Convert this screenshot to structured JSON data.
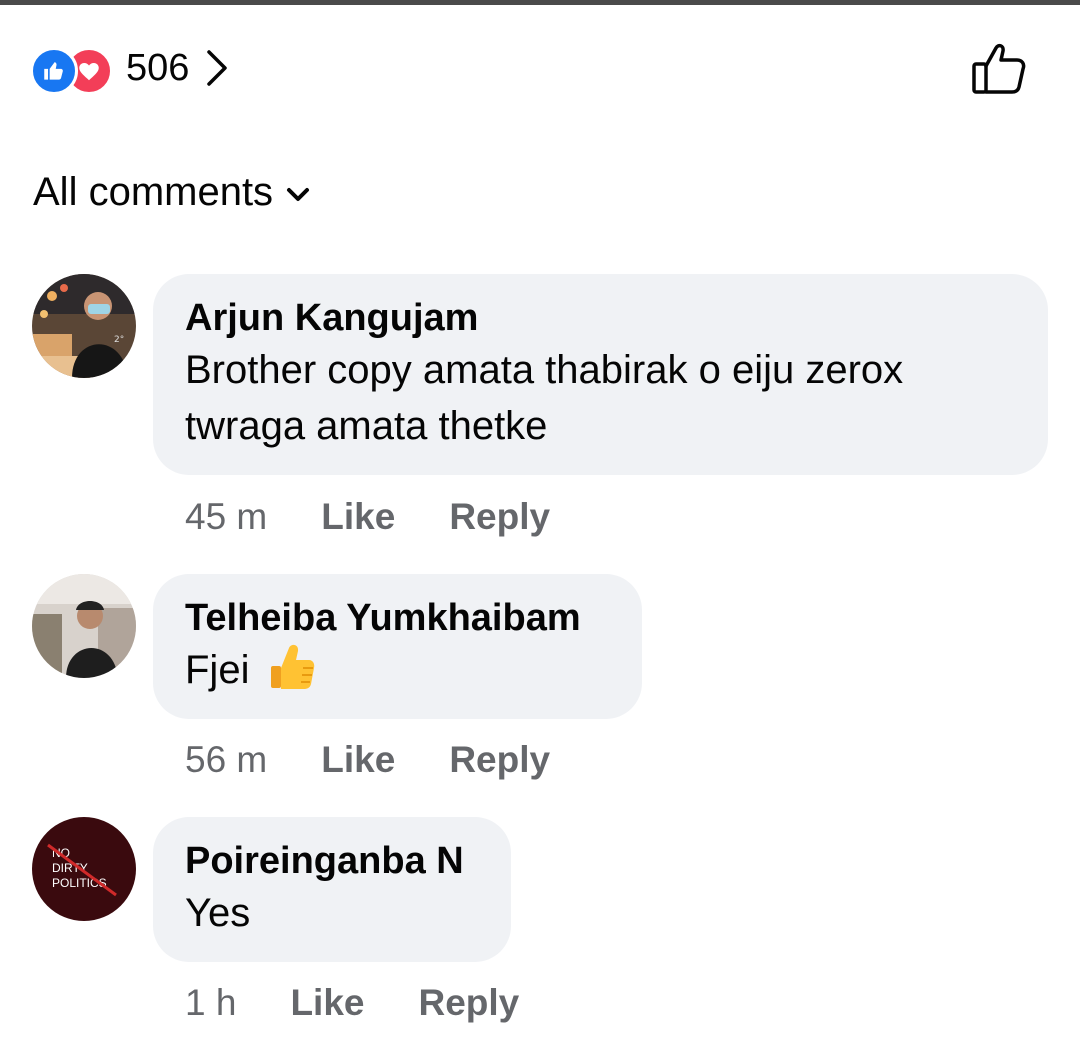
{
  "reactions": {
    "count": "506",
    "icons": [
      "like-reaction-icon",
      "love-reaction-icon"
    ]
  },
  "filter": {
    "label": "All comments"
  },
  "comments": [
    {
      "author": "Arjun Kangujam",
      "text_lines": [
        "Brother copy amata thabirak o eiju zerox",
        "twraga amata thetke"
      ],
      "time": "45 m",
      "like_label": "Like",
      "reply_label": "Reply"
    },
    {
      "author": "Telheiba Yumkhaibam",
      "text": "Fjei",
      "emoji": "thumbs-up",
      "time": "56 m",
      "like_label": "Like",
      "reply_label": "Reply"
    },
    {
      "author": "Poireinganba N",
      "text": "Yes",
      "avatar_text": [
        "NO",
        "DIRTY",
        "POLITICS"
      ],
      "time": "1 h",
      "like_label": "Like",
      "reply_label": "Reply"
    }
  ],
  "colors": {
    "like_blue": "#1877f2",
    "love_red": "#f33e58",
    "bubble_bg": "#f0f2f5",
    "meta_gray": "#65676b"
  }
}
